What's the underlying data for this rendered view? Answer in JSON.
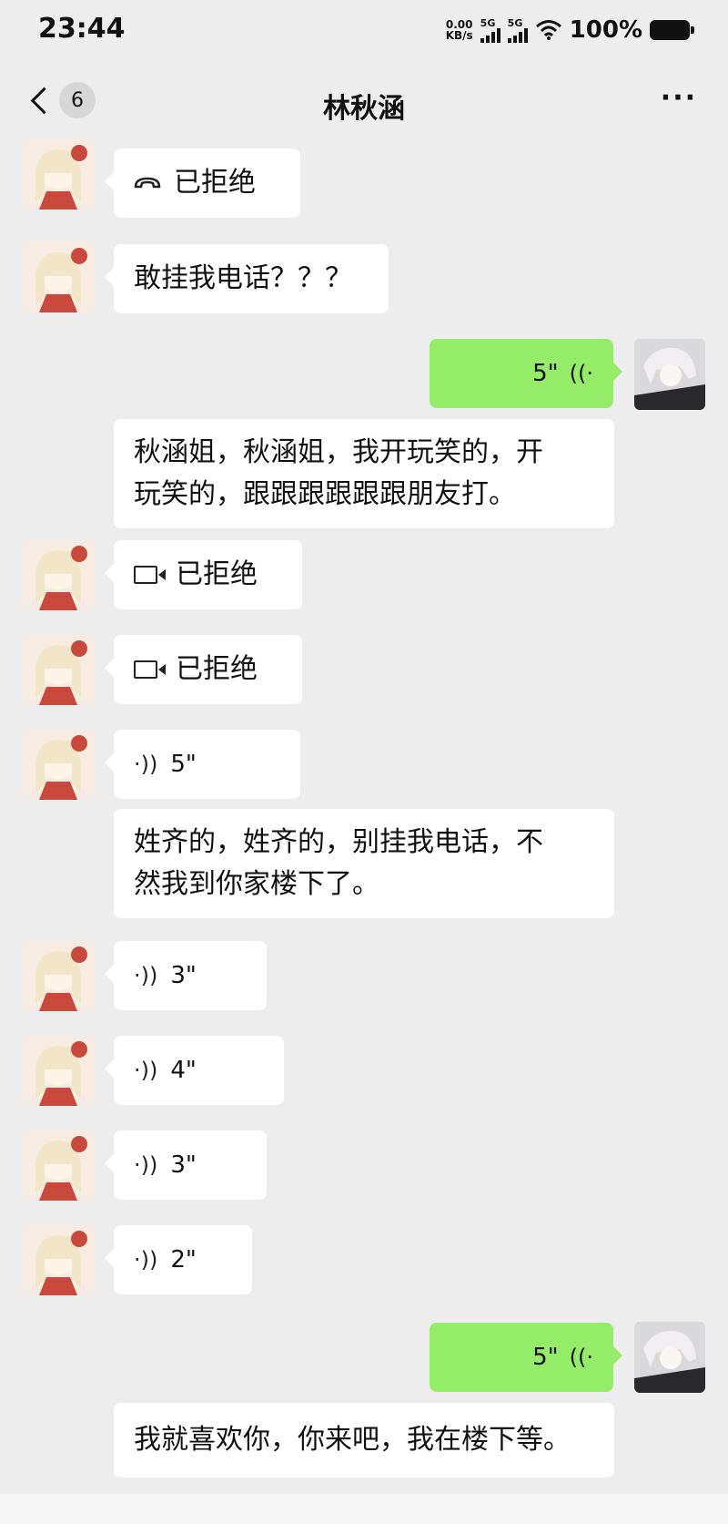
{
  "status_bar": {
    "time": "23:44",
    "net_speed_value": "0.00",
    "net_speed_unit": "KB/s",
    "sim1": "5G",
    "sim2": "5G",
    "battery": "100%"
  },
  "nav": {
    "back_badge": "6",
    "title": "林秋涵",
    "more": "···"
  },
  "messages": [
    {
      "side": "left",
      "type": "call",
      "icon": "phone-hangup-icon",
      "text": "已拒绝"
    },
    {
      "side": "left",
      "type": "text",
      "text": "敢挂我电话？？？"
    },
    {
      "side": "right",
      "type": "voice",
      "duration": "5\""
    },
    {
      "side": "right",
      "type": "transcript",
      "lines": [
        "秋涵姐，秋涵姐，我开玩笑的，开",
        "玩笑的，跟跟跟跟跟跟朋友打。"
      ]
    },
    {
      "side": "left",
      "type": "call",
      "icon": "video-call-icon",
      "text": "已拒绝"
    },
    {
      "side": "left",
      "type": "call",
      "icon": "video-call-icon",
      "text": "已拒绝"
    },
    {
      "side": "left",
      "type": "voice",
      "duration": "5\""
    },
    {
      "side": "left",
      "type": "transcript",
      "lines": [
        "姓齐的，姓齐的，别挂我电话，不",
        "然我到你家楼下了。"
      ]
    },
    {
      "side": "left",
      "type": "voice",
      "duration": "3\""
    },
    {
      "side": "left",
      "type": "voice",
      "duration": "4\""
    },
    {
      "side": "left",
      "type": "voice",
      "duration": "3\""
    },
    {
      "side": "left",
      "type": "voice",
      "duration": "2\""
    },
    {
      "side": "right",
      "type": "voice",
      "duration": "5\""
    },
    {
      "side": "right",
      "type": "transcript",
      "lines": [
        "我就喜欢你，你来吧，我在楼下等。"
      ]
    }
  ],
  "colors": {
    "background": "#ededed",
    "self_bubble": "#95ec69",
    "other_bubble": "#ffffff"
  }
}
